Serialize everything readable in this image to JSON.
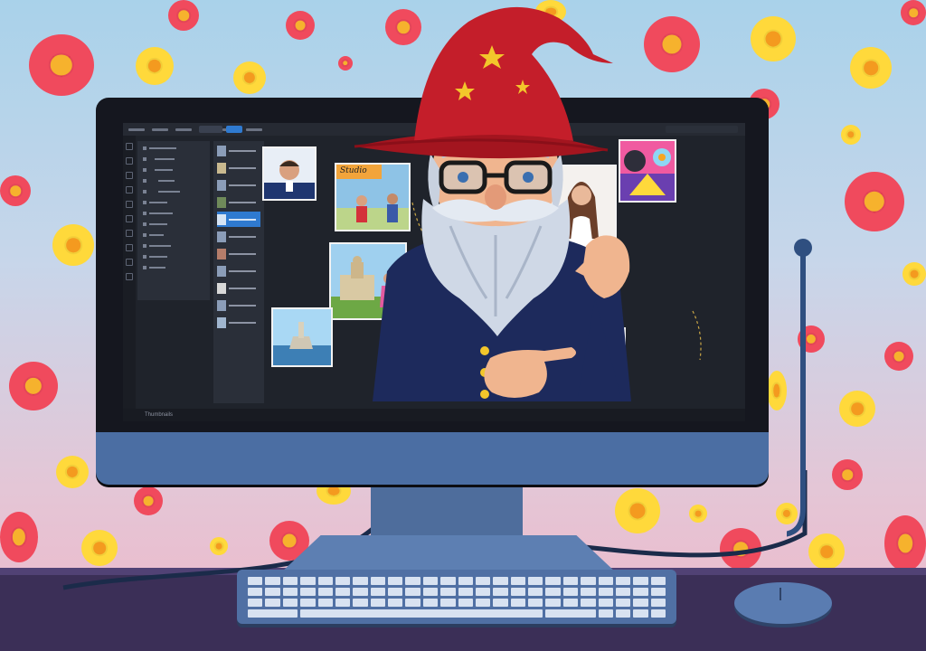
{
  "scene": {
    "subject": "wizard",
    "colors": {
      "hat": "#c41e2a",
      "coat": "#1d2a5c",
      "beard": "#cfd8e6",
      "monitor_frame": "#15171f",
      "monitor_chin": "#4b6ea3",
      "desk": "#3b2f57",
      "flower_red": "#f04a5d",
      "flower_yellow": "#ffd93b"
    }
  },
  "screen": {
    "status_text": "Thumbnails",
    "photo_caption": "Studio"
  }
}
